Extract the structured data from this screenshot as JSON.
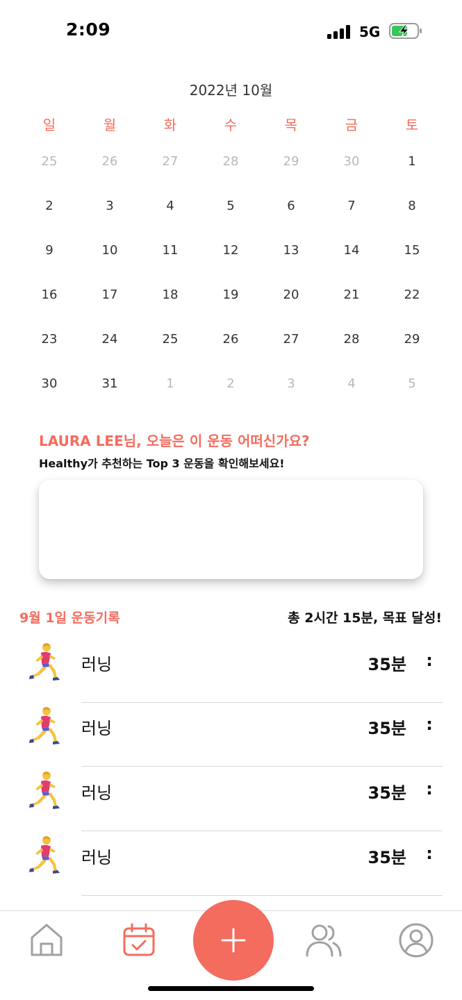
{
  "status_bar": {
    "time": "2:09",
    "network": "5G"
  },
  "calendar": {
    "title": "2022년 10월",
    "weekdays": [
      "일",
      "월",
      "화",
      "수",
      "목",
      "금",
      "토"
    ],
    "weeks": [
      [
        {
          "d": "25",
          "m": true
        },
        {
          "d": "26",
          "m": true
        },
        {
          "d": "27",
          "m": true
        },
        {
          "d": "28",
          "m": true
        },
        {
          "d": "29",
          "m": true
        },
        {
          "d": "30",
          "m": true
        },
        {
          "d": "1",
          "m": false
        }
      ],
      [
        {
          "d": "2",
          "m": false
        },
        {
          "d": "3",
          "m": false
        },
        {
          "d": "4",
          "m": false
        },
        {
          "d": "5",
          "m": false
        },
        {
          "d": "6",
          "m": false
        },
        {
          "d": "7",
          "m": false
        },
        {
          "d": "8",
          "m": false
        }
      ],
      [
        {
          "d": "9",
          "m": false
        },
        {
          "d": "10",
          "m": false
        },
        {
          "d": "11",
          "m": false
        },
        {
          "d": "12",
          "m": false
        },
        {
          "d": "13",
          "m": false
        },
        {
          "d": "14",
          "m": false
        },
        {
          "d": "15",
          "m": false
        }
      ],
      [
        {
          "d": "16",
          "m": false
        },
        {
          "d": "17",
          "m": false
        },
        {
          "d": "18",
          "m": false
        },
        {
          "d": "19",
          "m": false
        },
        {
          "d": "20",
          "m": false
        },
        {
          "d": "21",
          "m": false
        },
        {
          "d": "22",
          "m": false
        }
      ],
      [
        {
          "d": "23",
          "m": false
        },
        {
          "d": "24",
          "m": false
        },
        {
          "d": "25",
          "m": false
        },
        {
          "d": "26",
          "m": false
        },
        {
          "d": "27",
          "m": false
        },
        {
          "d": "28",
          "m": false
        },
        {
          "d": "29",
          "m": false
        }
      ],
      [
        {
          "d": "30",
          "m": false
        },
        {
          "d": "31",
          "m": false
        },
        {
          "d": "1",
          "m": true
        },
        {
          "d": "2",
          "m": true
        },
        {
          "d": "3",
          "m": true
        },
        {
          "d": "4",
          "m": true
        },
        {
          "d": "5",
          "m": true
        }
      ]
    ]
  },
  "recommendation": {
    "title": "LAURA LEE님, 오늘은 이 운동 어떠신가요?",
    "subtitle": "Healthy가 추천하는 Top 3 운동을 확인해보세요!"
  },
  "records": {
    "date_label": "9월 1일 운동기록",
    "summary": "총 2시간 15분, 목표 달성!",
    "items": [
      {
        "icon": "runner-icon",
        "name": "러닝",
        "duration": "35분",
        "more": ":"
      },
      {
        "icon": "runner-icon",
        "name": "러닝",
        "duration": "35분",
        "more": ":"
      },
      {
        "icon": "runner-icon",
        "name": "러닝",
        "duration": "35분",
        "more": ":"
      },
      {
        "icon": "runner-icon",
        "name": "러닝",
        "duration": "35분",
        "more": ":"
      }
    ]
  },
  "tab_bar": {
    "tabs": [
      {
        "name": "home",
        "icon": "home-icon",
        "active": false
      },
      {
        "name": "calendar",
        "icon": "calendar-check-icon",
        "active": true
      },
      {
        "name": "add",
        "icon": "plus-icon",
        "active": false
      },
      {
        "name": "friends",
        "icon": "users-icon",
        "active": false
      },
      {
        "name": "profile",
        "icon": "profile-icon",
        "active": false
      }
    ]
  },
  "colors": {
    "accent": "#f36c5e",
    "muted_text": "#b8b8b8",
    "inactive_icon": "#a0a0a0",
    "battery_charge": "#34c759"
  }
}
